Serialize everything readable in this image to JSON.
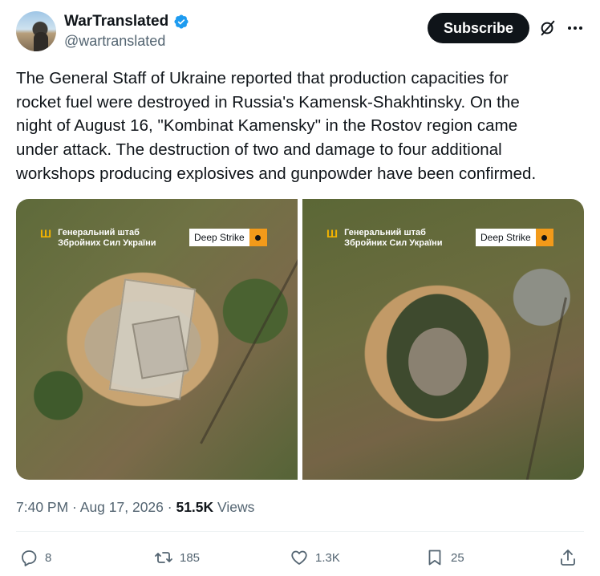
{
  "author": {
    "display_name": "WarTranslated",
    "handle": "@wartranslated"
  },
  "header": {
    "subscribe_label": "Subscribe",
    "icons": [
      "verified-badge-icon",
      "grok-icon",
      "more-icon"
    ]
  },
  "tweet": {
    "text": "The General Staff of Ukraine reported that production capacities for\nrocket fuel were destroyed in Russia's Kamensk-Shakhtinsky. On the\nnight of August 16, \"Kombinat Kamensky\" in the Rostov region came\nunder attack. The destruction of two and damage to four additional\nworkshops producing explosives and gunpowder have been confirmed."
  },
  "media": {
    "photos": [
      {
        "overlay_title": "Генеральний штаб\nЗбройних Сил України",
        "badge": "Deep Strike"
      },
      {
        "overlay_title": "Генеральний штаб\nЗбройних Сил України",
        "badge": "Deep Strike"
      }
    ],
    "trident_glyph": "Ш"
  },
  "meta": {
    "time": "7:40 PM",
    "separator": " · ",
    "date": "Aug 17, 2026",
    "views_count": "51.5K",
    "views_label": "Views"
  },
  "actions": {
    "replies": "8",
    "reposts": "185",
    "likes": "1.3K",
    "bookmarks": "25"
  },
  "colors": {
    "text": "#0f1419",
    "secondary": "#536471",
    "verified": "#1d9bf0",
    "badge_orange": "#f29a1a",
    "trident_gold": "#f4b400"
  }
}
